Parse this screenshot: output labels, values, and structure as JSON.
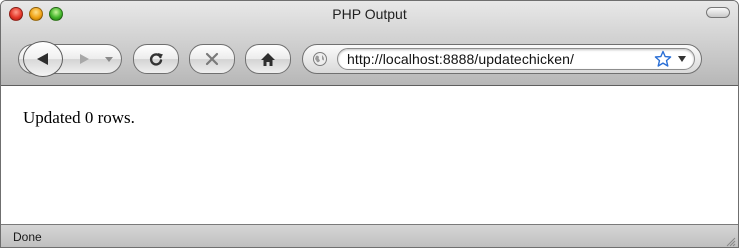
{
  "window": {
    "title": "PHP Output"
  },
  "toolbar": {
    "icons": {
      "back": "back-arrow-icon",
      "forward": "forward-arrow-icon",
      "history": "history-dropdown-icon",
      "reload": "reload-icon",
      "stop": "stop-x-icon",
      "home": "home-icon",
      "site": "globe-icon",
      "bookmark": "star-icon",
      "url_menu": "chevron-down-icon"
    }
  },
  "address_bar": {
    "url": "http://localhost:8888/updatechicken/"
  },
  "content": {
    "message": "Updated 0 rows."
  },
  "status_bar": {
    "text": "Done"
  },
  "colors": {
    "star_accent": "#2a6fd6",
    "close": "#e4372a",
    "minimize": "#f0a316",
    "zoom": "#43b52b"
  }
}
